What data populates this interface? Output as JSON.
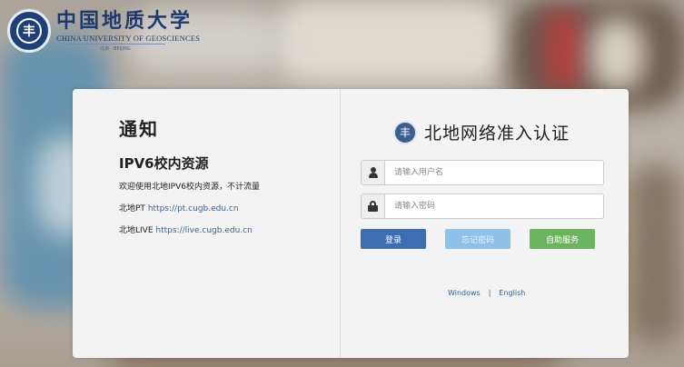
{
  "logo": {
    "seal_glyph": "丰",
    "cn_name": "中国地质大学",
    "en_name": "CHINA UNIVERSITY OF GEOSCIENCES",
    "sub": "北京 · BEIJING"
  },
  "notice": {
    "title": "通知",
    "subtitle": "IPV6校内资源",
    "text": "欢迎使用北地IPV6校内资源，不计流量",
    "pt_label": "北地PT",
    "pt_link": "https://pt.cugb.edu.cn",
    "live_label": "北地LIVE",
    "live_link": "https://live.cugb.edu.cn"
  },
  "auth": {
    "seal_glyph": "丰",
    "title": "北地网络准入认证",
    "username_placeholder": "请输入用户名",
    "password_placeholder": "请输入密码",
    "login_label": "登录",
    "forgot_label": "忘记密码",
    "self_service_label": "自助服务",
    "lang_windows": "Windows",
    "lang_sep": "|",
    "lang_english": "English"
  },
  "colors": {
    "login_button": "#3d6eb0",
    "forgot_button": "#8fc2e8",
    "self_service_button": "#6bb45e",
    "link": "#2f64a8"
  }
}
